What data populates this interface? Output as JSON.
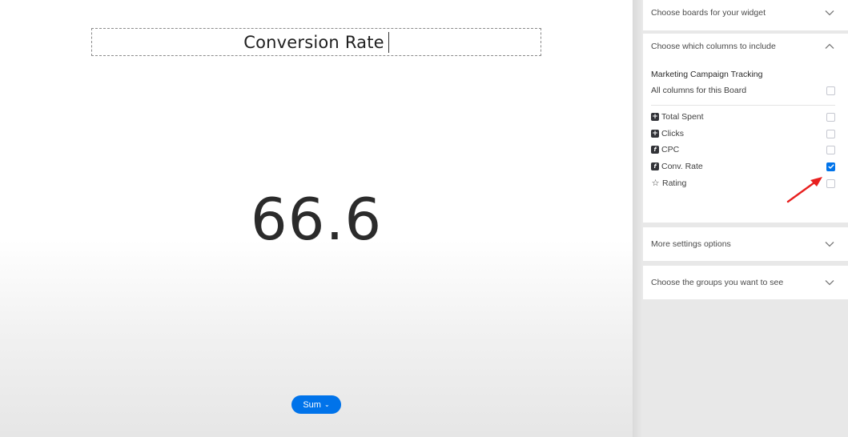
{
  "widget": {
    "title": "Conversion Rate",
    "value": "66.6",
    "aggregation": "Sum"
  },
  "panel": {
    "sections": {
      "boards": "Choose boards for your widget",
      "columns": "Choose which columns to include",
      "more": "More settings options",
      "groups": "Choose the groups you want to see"
    },
    "board_name": "Marketing Campaign Tracking",
    "all_columns_label": "All columns for this Board",
    "all_columns_checked": false,
    "columns": [
      {
        "label": "Total Spent",
        "icon": "plus-box-icon",
        "checked": false
      },
      {
        "label": "Clicks",
        "icon": "plus-box-icon",
        "checked": false
      },
      {
        "label": "CPC",
        "icon": "formula-icon",
        "checked": false
      },
      {
        "label": "Conv. Rate",
        "icon": "formula-icon",
        "checked": true
      },
      {
        "label": "Rating",
        "icon": "star-icon",
        "checked": false
      }
    ]
  },
  "colors": {
    "accent": "#0073ea",
    "annotation_arrow": "#e8201f"
  }
}
